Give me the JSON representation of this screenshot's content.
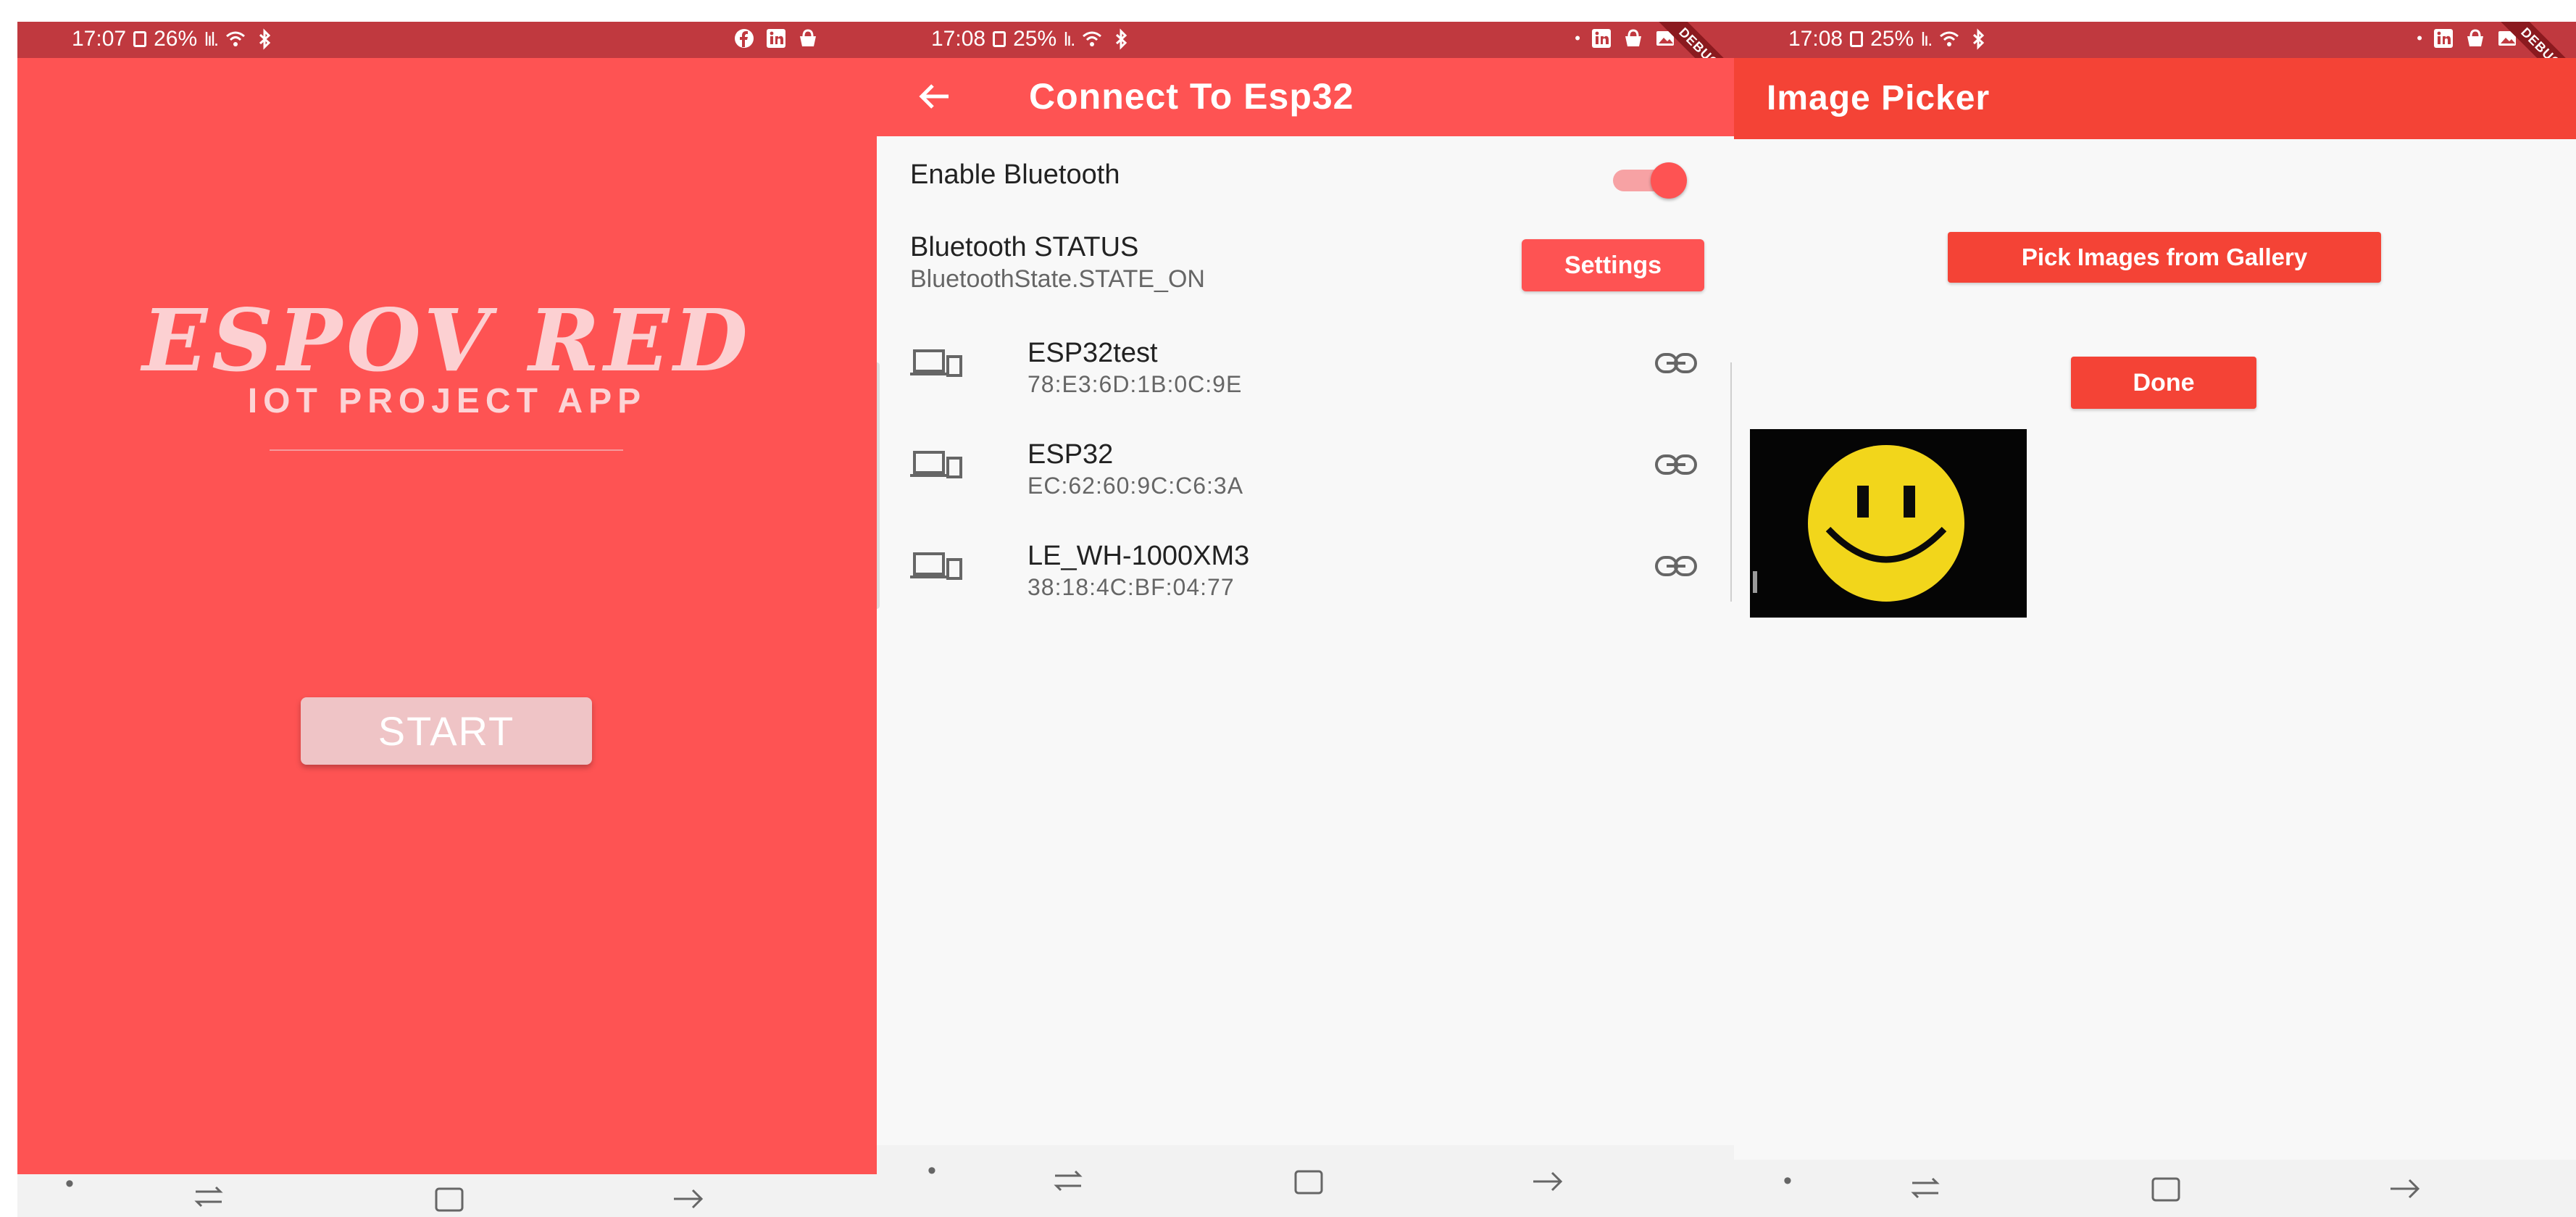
{
  "screens": [
    {
      "status": {
        "time": "17:07",
        "battery": "26%",
        "right_icons": [
          "facebook-icon",
          "linkedin-icon",
          "shop-icon"
        ]
      },
      "brand": {
        "title": "ESPOV RED",
        "subtitle": "IOT PROJECT APP"
      },
      "start_label": "START"
    },
    {
      "status": {
        "time": "17:08",
        "battery": "25%",
        "right_icons": [
          "dot-icon",
          "linkedin-icon",
          "shop-icon",
          "image-icon"
        ]
      },
      "appbar": {
        "title": "Connect To Esp32"
      },
      "enable_bluetooth": {
        "label": "Enable Bluetooth",
        "on": true
      },
      "bt_status": {
        "title": "Bluetooth STATUS",
        "value": "BluetoothState.STATE_ON",
        "settings_label": "Settings"
      },
      "devices": [
        {
          "name": "ESP32test",
          "address": "78:E3:6D:1B:0C:9E"
        },
        {
          "name": "ESP32",
          "address": "EC:62:60:9C:C6:3A"
        },
        {
          "name": "LE_WH-1000XM3",
          "address": "38:18:4C:BF:04:77"
        }
      ],
      "debug_label": "DEBUG"
    },
    {
      "status": {
        "time": "17:08",
        "battery": "25%",
        "right_icons": [
          "dot-icon",
          "linkedin-icon",
          "shop-icon",
          "image-icon"
        ]
      },
      "appbar": {
        "title": "Image Picker"
      },
      "pick_label": "Pick Images from Gallery",
      "done_label": "Done",
      "debug_label": "DEBUG"
    }
  ],
  "colors": {
    "primary": "#fe5353",
    "image_picker_primary": "#f44336",
    "status_bar": "#c0393f",
    "brand_text": "#fcd0d2"
  },
  "nav_icons": [
    "dot-icon",
    "recents-icon",
    "home-icon",
    "back-icon"
  ]
}
